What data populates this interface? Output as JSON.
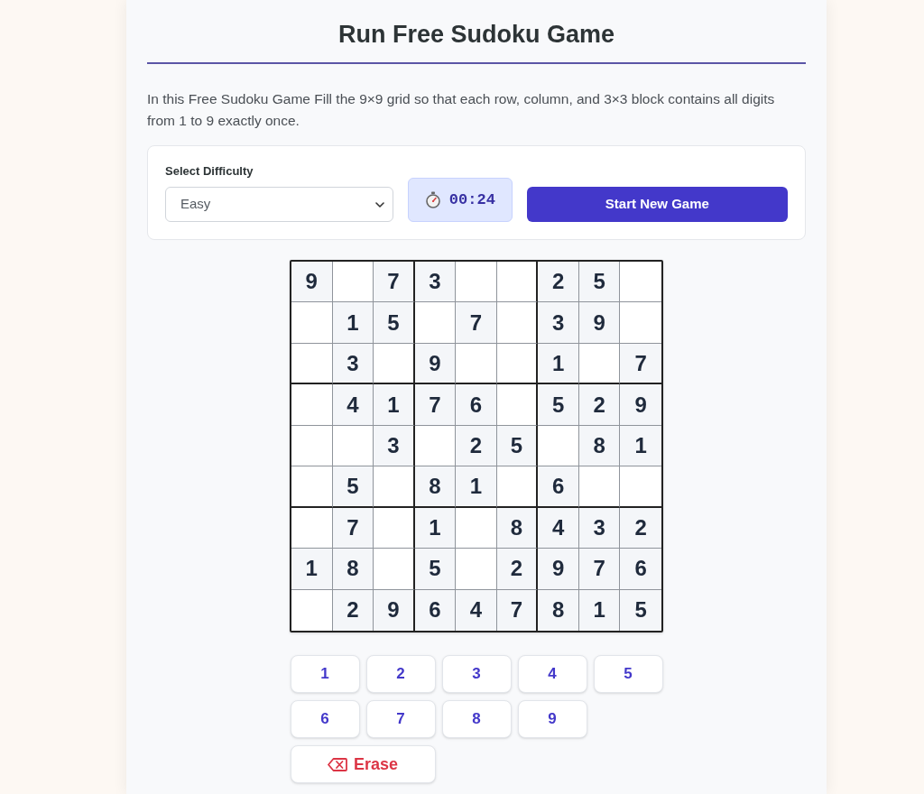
{
  "title": "Run Free Sudoku Game",
  "intro": "In this Free Sudoku Game Fill the 9×9 grid so that each row, column, and 3×3 block contains all digits from 1 to 9 exactly once.",
  "controls": {
    "difficulty_label": "Select Difficulty",
    "difficulty_select": {
      "value": "Easy"
    },
    "timer": "00:24",
    "start_button": "Start New Game"
  },
  "grid": {
    "rows": [
      [
        "9",
        null,
        "7",
        "3",
        null,
        null,
        "2",
        "5",
        null
      ],
      [
        null,
        "1",
        "5",
        null,
        "7",
        null,
        "3",
        "9",
        null
      ],
      [
        null,
        "3",
        null,
        "9",
        null,
        null,
        "1",
        null,
        "7"
      ],
      [
        null,
        "4",
        "1",
        "7",
        "6",
        null,
        "5",
        "2",
        "9"
      ],
      [
        null,
        null,
        "3",
        null,
        "2",
        "5",
        null,
        "8",
        "1"
      ],
      [
        null,
        "5",
        null,
        "8",
        "1",
        null,
        "6",
        null,
        null
      ],
      [
        null,
        "7",
        null,
        "1",
        null,
        "8",
        "4",
        "3",
        "2"
      ],
      [
        "1",
        "8",
        null,
        "5",
        null,
        "2",
        "9",
        "7",
        "6"
      ],
      [
        null,
        "2",
        "9",
        "6",
        "4",
        "7",
        "8",
        "1",
        "5"
      ]
    ]
  },
  "number_pad": {
    "keys": [
      "1",
      "2",
      "3",
      "4",
      "5",
      "6",
      "7",
      "8",
      "9"
    ],
    "erase_button": "Erase"
  }
}
